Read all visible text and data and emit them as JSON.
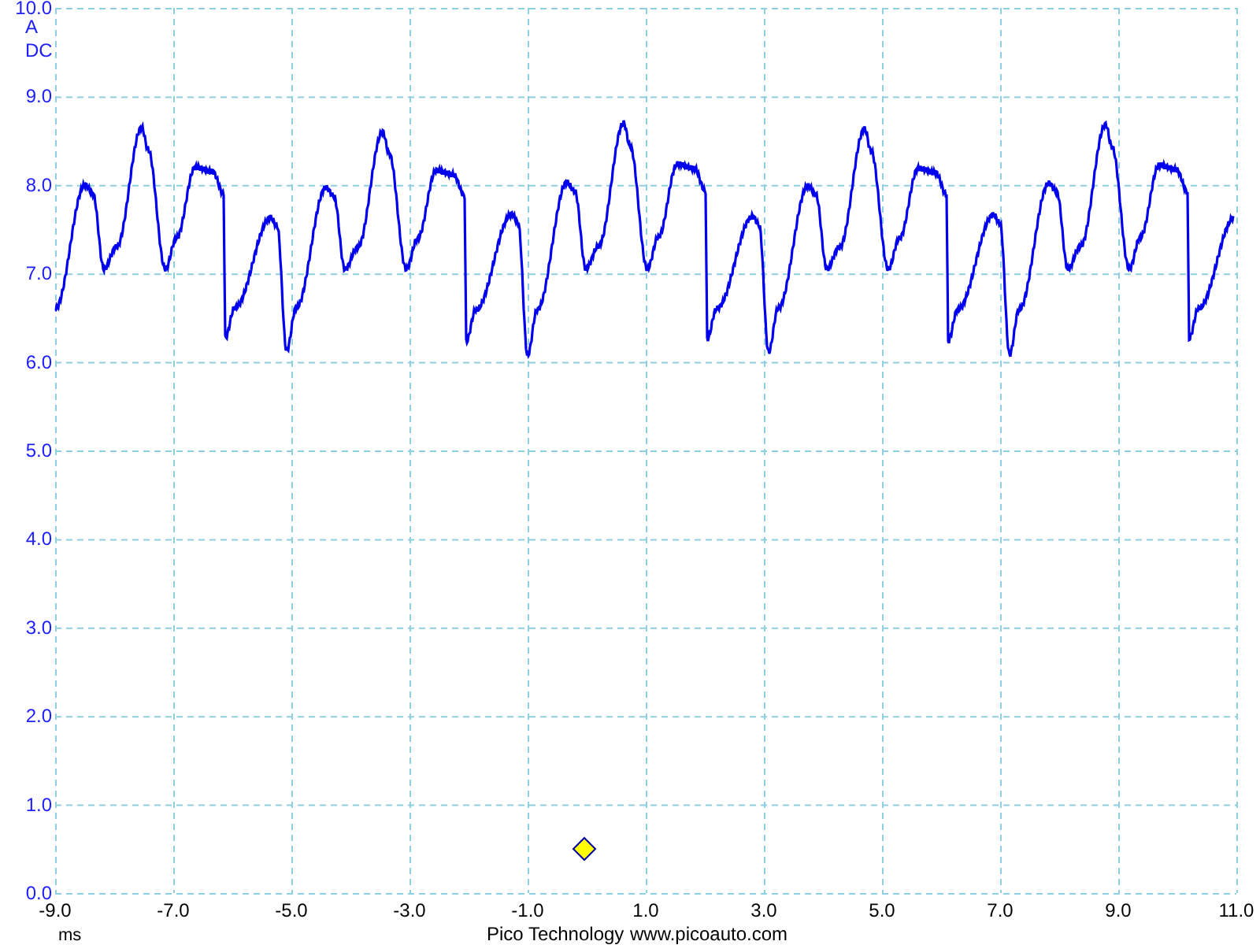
{
  "y_axis": {
    "ticks": [
      "10.0",
      "9.0",
      "8.0",
      "7.0",
      "6.0",
      "5.0",
      "4.0",
      "3.0",
      "2.0",
      "1.0",
      "0.0"
    ],
    "unit": "A",
    "coupling": "DC"
  },
  "x_axis": {
    "ticks": [
      "-9.0",
      "-7.0",
      "-5.0",
      "-3.0",
      "-1.0",
      "1.0",
      "3.0",
      "5.0",
      "7.0",
      "9.0",
      "11.0"
    ],
    "unit": "ms"
  },
  "footer": {
    "company": "Pico Technology",
    "website": "www.picoauto.com"
  }
}
